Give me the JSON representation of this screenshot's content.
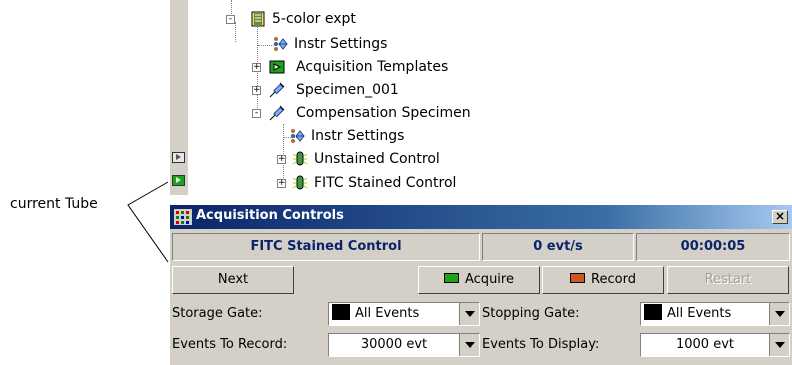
{
  "tree": {
    "items": [
      {
        "label": "5-color expt",
        "icon": "experiment-icon",
        "expander": "-"
      },
      {
        "label": "Instr Settings",
        "icon": "instrument-settings-icon"
      },
      {
        "label": "Acquisition Templates",
        "icon": "acquisition-templates-icon",
        "expander": "+"
      },
      {
        "label": "Specimen_001",
        "icon": "specimen-syringe-icon",
        "expander": "+"
      },
      {
        "label": "Compensation Specimen",
        "icon": "specimen-syringe-icon",
        "expander": "-"
      },
      {
        "label": "Instr Settings",
        "icon": "instrument-settings-icon"
      },
      {
        "label": "Unstained Control",
        "icon": "tube-icon",
        "expander": "+"
      },
      {
        "label": "FITC Stained Control",
        "icon": "tube-icon",
        "expander": "+"
      }
    ]
  },
  "callout": {
    "label": "current Tube"
  },
  "window": {
    "title": "Acquisition Controls",
    "close": "×",
    "status": {
      "tube": "FITC Stained Control",
      "rate": "0 evt/s",
      "time": "00:00:05"
    },
    "buttons": {
      "next": "Next",
      "acquire": "Acquire",
      "record": "Record",
      "restart": "Restart"
    },
    "storage_gate": {
      "label": "Storage Gate:",
      "value": "All Events"
    },
    "stopping_gate": {
      "label": "Stopping Gate:",
      "value": "All Events"
    },
    "events_to_record": {
      "label": "Events To Record:",
      "value": "30000 evt"
    },
    "events_to_display": {
      "label": "Events To Display:",
      "value": "1000 evt"
    }
  },
  "colors": {
    "title_start": "#0a246a",
    "title_end": "#a6caf0",
    "status_text": "#0a246a",
    "acquire": "#1ca21c",
    "record": "#c85a1e"
  }
}
